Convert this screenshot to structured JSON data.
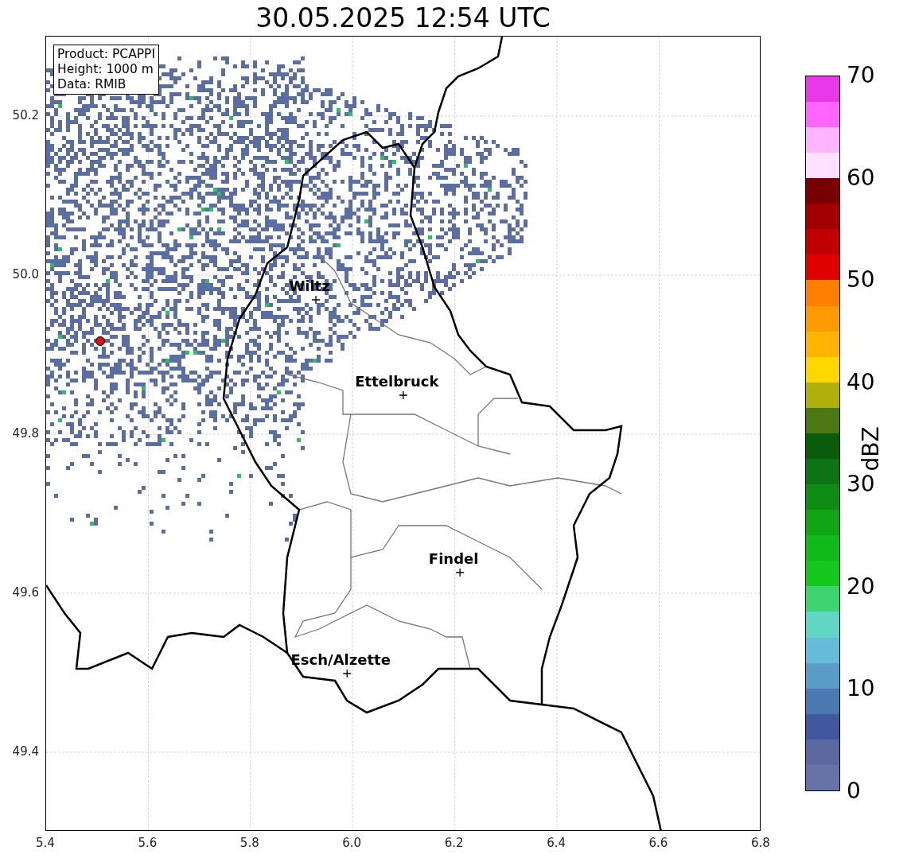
{
  "title": "30.05.2025 12:54 UTC",
  "info_box": [
    "Product: PCAPPI",
    "Height: 1000 m",
    "Data: RMIB"
  ],
  "map": {
    "xticks": [
      "5.4",
      "5.6",
      "5.8",
      "6.0",
      "6.2",
      "6.4",
      "6.6",
      "6.8"
    ],
    "yticks": [
      "50.2",
      "50.0",
      "49.8",
      "49.6",
      "49.4"
    ],
    "cities": [
      {
        "name": "Wiltz"
      },
      {
        "name": "Ettelbruck"
      },
      {
        "name": "Findel"
      },
      {
        "name": "Esch/Alzette"
      }
    ]
  },
  "colorbar": {
    "label": "dBZ",
    "ticks": [
      "70",
      "60",
      "50",
      "40",
      "30",
      "20",
      "10",
      "0"
    ]
  }
}
